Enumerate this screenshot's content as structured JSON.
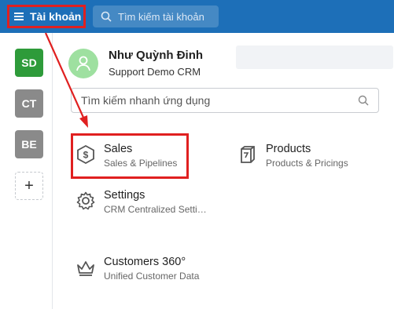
{
  "topbar": {
    "menu_label": "Tài khoản",
    "search_placeholder": "Tìm kiếm tài khoản"
  },
  "workspaces": [
    {
      "initials": "SD",
      "color": "#2e9b3a"
    },
    {
      "initials": "CT",
      "color": "#8a8a8a"
    },
    {
      "initials": "BE",
      "color": "#8a8a8a"
    }
  ],
  "workspace_add": "+",
  "user": {
    "name": "Như Quỳnh Đinh",
    "subtitle": "Support Demo CRM"
  },
  "app_search": {
    "placeholder": "Tìm kiếm nhanh ứng dụng"
  },
  "apps": [
    {
      "title": "Sales",
      "subtitle": "Sales & Pipelines"
    },
    {
      "title": "Products",
      "subtitle": "Products & Pricings"
    },
    {
      "title": "Settings",
      "subtitle": "CRM Centralized Settings"
    },
    {
      "title": "Customers 360°",
      "subtitle": "Unified Customer Data"
    }
  ],
  "colors": {
    "topbar": "#1d6fb8",
    "highlight": "#e02020"
  }
}
